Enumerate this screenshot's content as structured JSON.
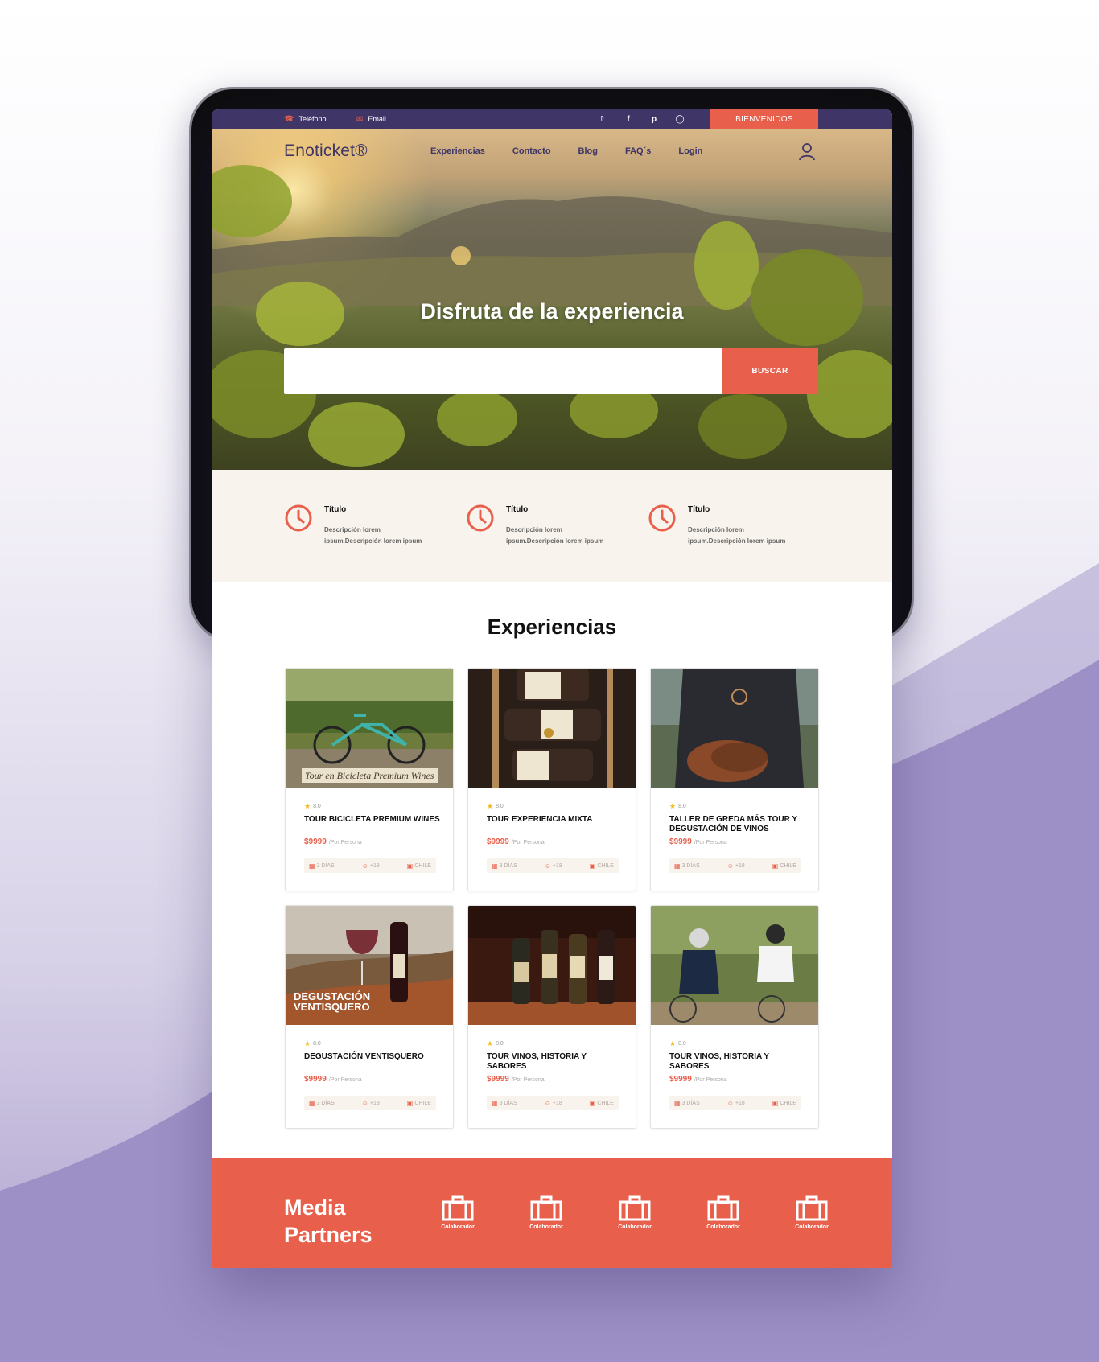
{
  "topbar": {
    "phone_label": "Teléfono",
    "email_label": "Email",
    "social_icons": [
      "twitter-icon",
      "facebook-icon",
      "pinterest-icon",
      "instagram-icon"
    ],
    "welcome_button": "BIENVENIDOS"
  },
  "header": {
    "logo": "Enoticket®",
    "menu": [
      "Experiencias",
      "Contacto",
      "Blog",
      "FAQ´s",
      "Login"
    ]
  },
  "hero": {
    "title": "Disfruta de la experiencia",
    "search_placeholder": "",
    "search_button": "BUSCAR"
  },
  "features": [
    {
      "title": "Título",
      "description": "Descripción lorem ipsum.Descripción lorem ipsum"
    },
    {
      "title": "Título",
      "description": "Descripción lorem ipsum.Descripción lorem ipsum"
    },
    {
      "title": "Título",
      "description": "Descripción lorem ipsum.Descripción lorem ipsum"
    }
  ],
  "experiences": {
    "title": "Experiencias",
    "cards": [
      {
        "rating": "8.0",
        "name": "TOUR BICICLETA PREMIUM WINES",
        "price": "$9999",
        "per": "/Por Persona",
        "days": "3 DÍAS",
        "age": "+18",
        "country": "CHILE",
        "image_caption": "Tour en Bicicleta Premium Wines"
      },
      {
        "rating": "8.0",
        "name": "TOUR EXPERIENCIA MIXTA",
        "price": "$9999",
        "per": "/Por Persona",
        "days": "3 DÍAS",
        "age": "+18",
        "country": "CHILE"
      },
      {
        "rating": "8.0",
        "name": "TALLER DE GREDA MÁS TOUR Y DEGUSTACIÓN DE VINOS",
        "price": "$9999",
        "per": "/Por Persona",
        "days": "3 DÍAS",
        "age": "+18",
        "country": "CHILE"
      },
      {
        "rating": "8.0",
        "name": "DEGUSTACIÓN VENTISQUERO",
        "price": "$9999",
        "per": "/Por Persona",
        "days": "3 DÍAS",
        "age": "+18",
        "country": "CHILE",
        "image_caption": "DEGUSTACIÓN VENTISQUERO"
      },
      {
        "rating": "8.0",
        "name": "TOUR VINOS, HISTORIA Y SABORES",
        "price": "$9999",
        "per": "/Por Persona",
        "days": "3 DÍAS",
        "age": "+18",
        "country": "CHILE"
      },
      {
        "rating": "8.0",
        "name": "TOUR VINOS, HISTORIA Y SABORES",
        "price": "$9999",
        "per": "/Por Persona",
        "days": "3 DÍAS",
        "age": "+18",
        "country": "CHILE"
      }
    ]
  },
  "partners": {
    "title_line1": "Media",
    "title_line2": "Partners",
    "items": [
      "Colaborador",
      "Colaborador",
      "Colaborador",
      "Colaborador",
      "Colaborador"
    ]
  },
  "colors": {
    "brand_purple": "#3f3566",
    "accent_coral": "#e8604c",
    "cream": "#f8f3ec"
  }
}
